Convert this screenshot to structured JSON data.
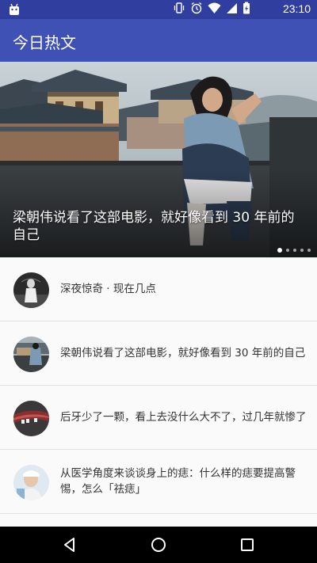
{
  "status_bar": {
    "time": "23:10",
    "icons": [
      "android-icon",
      "vibrate-icon",
      "alarm-icon",
      "wifi-icon",
      "signal-icon",
      "battery-charging-icon"
    ]
  },
  "app_bar": {
    "title": "今日热文"
  },
  "banner": {
    "caption": "梁朝伟说看了这部电影，就好像看到 30 年前的自己",
    "page_count": 5,
    "active_page": 1
  },
  "stories": [
    {
      "title": "深夜惊奇 · 现在几点"
    },
    {
      "title": "梁朝伟说看了这部电影，就好像看到 30 年前的自己"
    },
    {
      "title": "后牙少了一颗，看上去没什么大不了，过几年就惨了"
    },
    {
      "title": "从医学角度来谈谈身上的痣：什么样的痣要提高警惕，怎么「祛痣」"
    }
  ],
  "nav_bar": {
    "icons": [
      "back-icon",
      "home-icon",
      "recents-icon"
    ]
  },
  "colors": {
    "primary": "#3f51b5",
    "primary_dark": "#303f9f"
  }
}
